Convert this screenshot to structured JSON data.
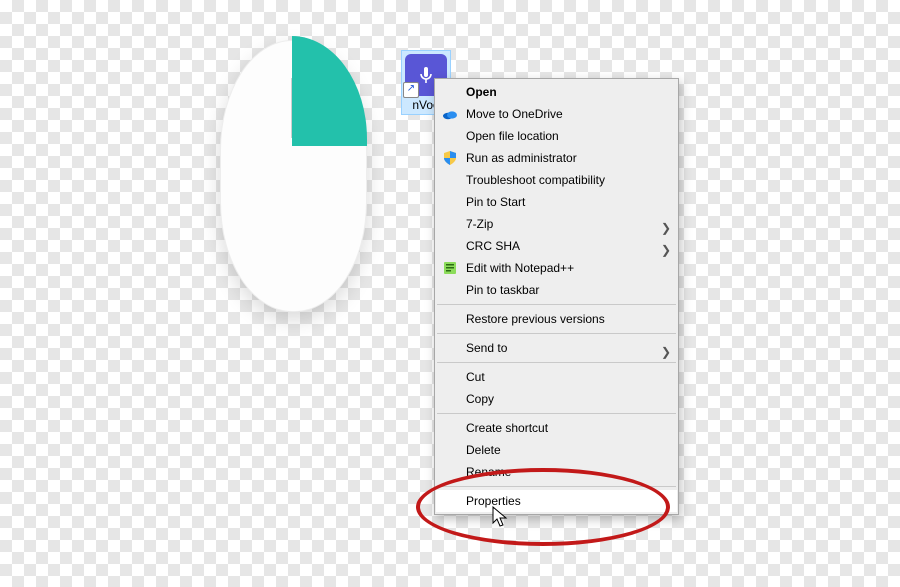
{
  "shortcut": {
    "label": "nVoo"
  },
  "menu": {
    "open": "Open",
    "move_to_onedrive": "Move to OneDrive",
    "open_file_location": "Open file location",
    "run_as_admin": "Run as administrator",
    "troubleshoot": "Troubleshoot compatibility",
    "pin_to_start": "Pin to Start",
    "seven_zip": "7-Zip",
    "crc_sha": "CRC SHA",
    "edit_notepadpp": "Edit with Notepad++",
    "pin_to_taskbar": "Pin to taskbar",
    "restore_prev": "Restore previous versions",
    "send_to": "Send to",
    "cut": "Cut",
    "copy": "Copy",
    "create_shortcut": "Create shortcut",
    "delete": "Delete",
    "rename": "Rename",
    "properties": "Properties"
  }
}
